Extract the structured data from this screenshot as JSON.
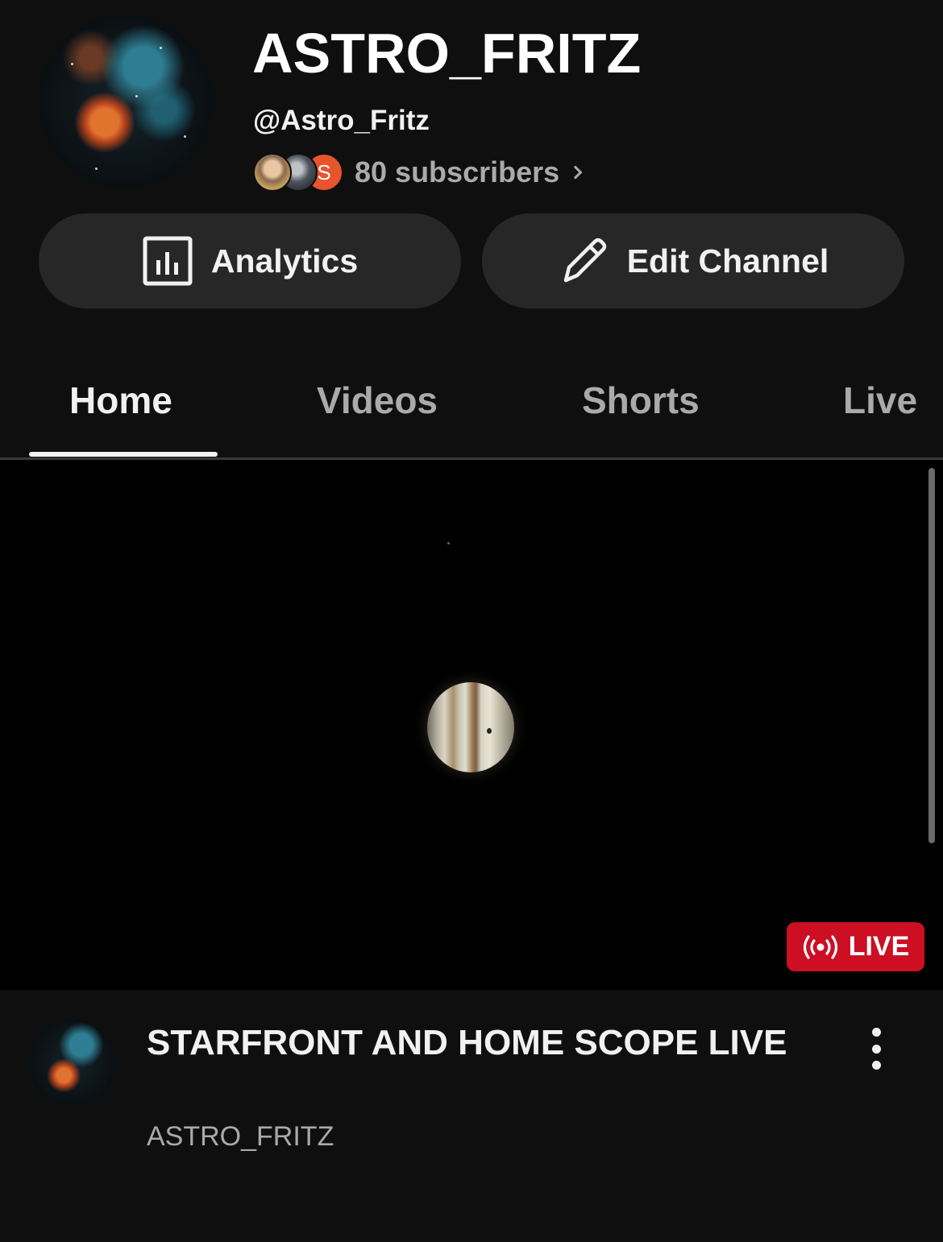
{
  "channel": {
    "title": "ASTRO_FRITZ",
    "handle": "@Astro_Fritz",
    "subscribers_text": "80 subscribers",
    "subscriber_avatar_initial": "S"
  },
  "actions": {
    "analytics_label": "Analytics",
    "edit_label": "Edit Channel"
  },
  "tabs": [
    {
      "label": "Home",
      "active": true
    },
    {
      "label": "Videos",
      "active": false
    },
    {
      "label": "Shorts",
      "active": false
    },
    {
      "label": "Live",
      "active": false
    }
  ],
  "featured_video": {
    "badge_label": "LIVE",
    "title": "STARFRONT AND HOME SCOPE LIVE",
    "channel_name": "ASTRO_FRITZ"
  },
  "colors": {
    "background": "#0f0f0f",
    "button_bg": "#272727",
    "live_red": "#cc0f23",
    "secondary_text": "#aaaaaa"
  },
  "icons": [
    "analytics-icon",
    "pencil-icon",
    "live-broadcast-icon",
    "more-vert-icon",
    "chevron-right-icon"
  ]
}
